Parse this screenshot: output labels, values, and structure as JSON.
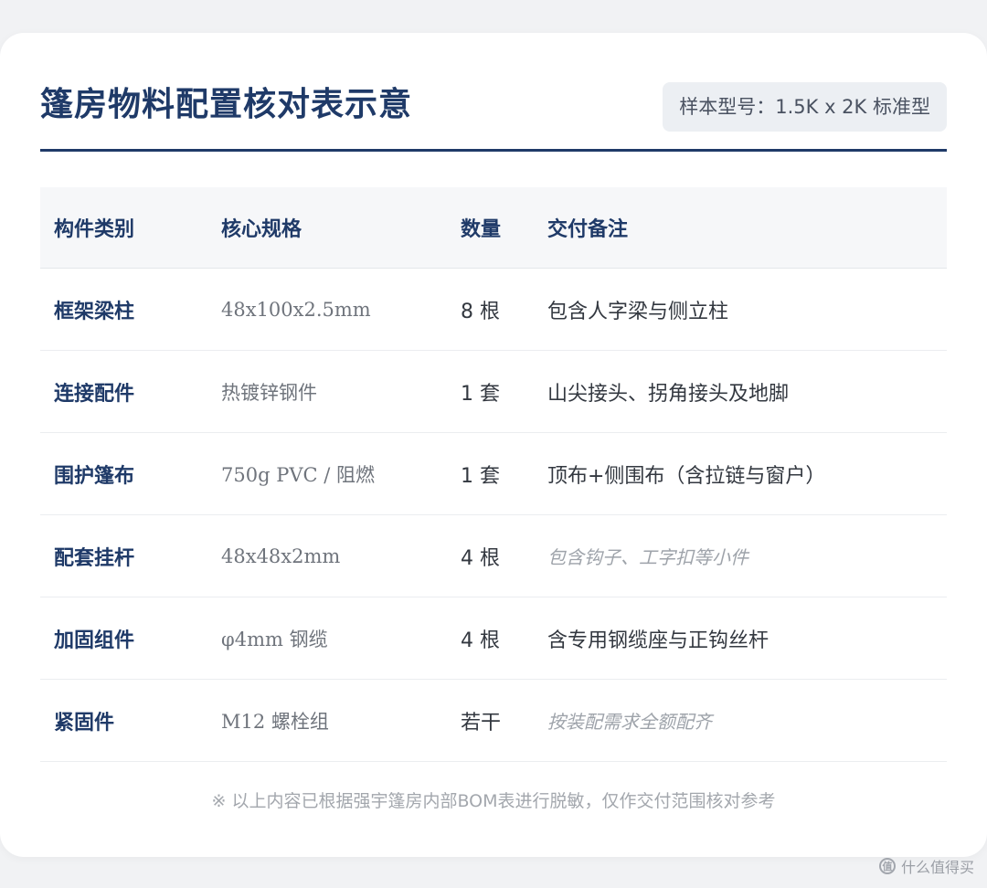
{
  "title": "篷房物料配置核对表示意",
  "model_badge": "样本型号：1.5K x 2K 标准型",
  "table": {
    "headers": [
      "构件类别",
      "核心规格",
      "数量",
      "交付备注"
    ],
    "rows": [
      {
        "category": "框架梁柱",
        "spec": "48x100x2.5mm",
        "qty": "8 根",
        "note": "包含人字梁与侧立柱",
        "note_muted": false
      },
      {
        "category": "连接配件",
        "spec": "热镀锌钢件",
        "qty": "1 套",
        "note": "山尖接头、拐角接头及地脚",
        "note_muted": false
      },
      {
        "category": "围护篷布",
        "spec": "750g PVC / 阻燃",
        "qty": "1 套",
        "note": "顶布+侧围布（含拉链与窗户）",
        "note_muted": false
      },
      {
        "category": "配套挂杆",
        "spec": "48x48x2mm",
        "qty": "4 根",
        "note": "包含钩子、工字扣等小件",
        "note_muted": true
      },
      {
        "category": "加固组件",
        "spec": "φ4mm 钢缆",
        "qty": "4 根",
        "note": "含专用钢缆座与正钩丝杆",
        "note_muted": false
      },
      {
        "category": "紧固件",
        "spec": "M12 螺栓组",
        "qty": "若干",
        "note": "按装配需求全额配齐",
        "note_muted": true
      }
    ]
  },
  "footnote": "※ 以上内容已根据强宇篷房内部BOM表进行脱敏，仅作交付范围核对参考",
  "watermark": {
    "icon_text": "值",
    "text": "什么值得买"
  },
  "colors": {
    "accent": "#1f3a68",
    "muted": "#9ea3aa"
  }
}
